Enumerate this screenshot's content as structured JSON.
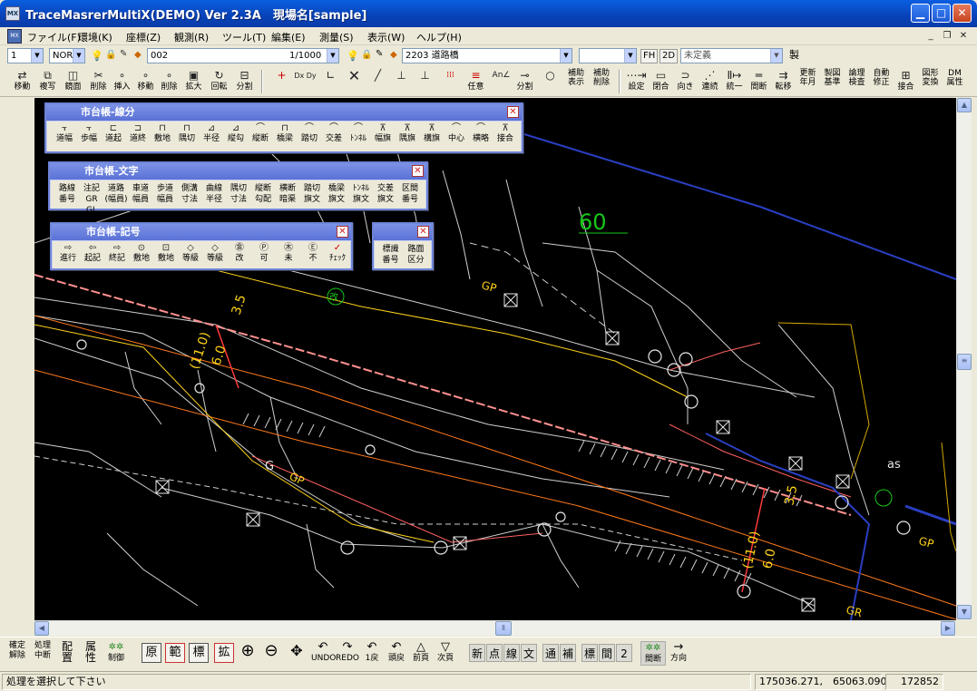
{
  "window": {
    "title": "TraceMasrerMultiX(DEMO) Ver 2.3A　現場名[sample]",
    "app_icon": "MX"
  },
  "menu": [
    "ファイル(F)",
    "環境(K)",
    "座標(Z)",
    "観測(R)",
    "ツール(T)",
    "編集(E)",
    "測量(S)",
    "表示(W)",
    "ヘルプ(H)"
  ],
  "row2": {
    "layer": "1",
    "mode": "NOR",
    "drawing_code": "002",
    "scale": "1/1000",
    "road_code": "2203 道路橋",
    "blank_combo": "",
    "fh": "FH",
    "twod": "2D",
    "undefined": "未定義",
    "make": "製"
  },
  "toolbar": [
    {
      "l1": "移動",
      "icon": "⇄"
    },
    {
      "l1": "複写",
      "icon": "⧉"
    },
    {
      "l1": "鏡面",
      "icon": "◫"
    },
    {
      "l1": "削除",
      "icon": "✂"
    },
    {
      "l1": "挿入",
      "icon": "∘"
    },
    {
      "l1": "移動",
      "icon": "∘"
    },
    {
      "l1": "削除",
      "icon": "∘"
    },
    {
      "l1": "拡大",
      "icon": "▣"
    },
    {
      "l1": "回転",
      "icon": "↻"
    },
    {
      "l1": "分割",
      "icon": "⊟"
    }
  ],
  "toolbar_mid": {
    "aux": "任意",
    "split": "分割",
    "hojo1": "補助",
    "disp": "表示",
    "hojo2": "補助",
    "del": "削除"
  },
  "toolbar_right": [
    {
      "l1": "",
      "l2": "設定"
    },
    {
      "l1": "",
      "l2": "閉合"
    },
    {
      "l1": "",
      "l2": "向き"
    },
    {
      "l1": "",
      "l2": "連続"
    },
    {
      "l1": "",
      "l2": "統一"
    },
    {
      "l1": "",
      "l2": "間断"
    },
    {
      "l1": "",
      "l2": "転移"
    },
    {
      "l1": "更新",
      "l2": "年月"
    },
    {
      "l1": "製図",
      "l2": "基準"
    },
    {
      "l1": "論理",
      "l2": "検査"
    },
    {
      "l1": "自動",
      "l2": "修正"
    },
    {
      "l1": "",
      "l2": "接合"
    },
    {
      "l1": "図形",
      "l2": "変換"
    },
    {
      "l1": "DM",
      "l2": "属性"
    }
  ],
  "palettes": {
    "lines": {
      "title": "市台帳-線分",
      "items": [
        "道幅",
        "歩幅",
        "道起",
        "道終",
        "敷地",
        "隅切",
        "半径",
        "縦勾",
        "縦断",
        "橋梁",
        "踏切",
        "交差",
        "ﾄﾝﾈﾙ",
        "幅旗",
        "隅旗",
        "構旗",
        "中心",
        "横略",
        "接合"
      ]
    },
    "text": {
      "title": "市台帳-文字",
      "items": [
        [
          "路線",
          "番号"
        ],
        [
          "注記",
          "GR GL"
        ],
        [
          "道路",
          "(幅員)"
        ],
        [
          "車道",
          "幅員"
        ],
        [
          "歩道",
          "幅員"
        ],
        [
          "側溝",
          "寸法"
        ],
        [
          "曲線",
          "半径"
        ],
        [
          "隅切",
          "寸法"
        ],
        [
          "縦断",
          "勾配"
        ],
        [
          "横断",
          "暗渠"
        ],
        [
          "踏切",
          "旗文"
        ],
        [
          "橋梁",
          "旗文"
        ],
        [
          "ﾄﾝﾈﾙ",
          "旗文"
        ],
        [
          "交差",
          "旗文"
        ],
        [
          "区間",
          "番号"
        ]
      ]
    },
    "symbols": {
      "title": "市台帳-記号",
      "items": [
        "進行",
        "起記",
        "終記",
        "敷地",
        "敷地",
        "等級",
        "等級",
        "改",
        "可",
        "未",
        "不",
        "ﾁｪｯｸ"
      ]
    },
    "small": {
      "items": [
        [
          "標識",
          "番号"
        ],
        [
          "路面",
          "区分"
        ]
      ]
    }
  },
  "drawing_labels": {
    "num60": "60",
    "gp1": "GP",
    "gp2": "GP",
    "gp3": "GP",
    "g": "G",
    "as": "as",
    "gr": "GR",
    "kai": "改",
    "w1": "(11.0)",
    "w2": "6.0",
    "w3": "3.5"
  },
  "bottom": {
    "left": [
      [
        "確定",
        "解除"
      ],
      [
        "処理",
        "中断"
      ],
      [
        "配",
        "置"
      ],
      [
        "属",
        "性"
      ],
      [
        "",
        "制御"
      ]
    ],
    "boxes": [
      "原",
      "範",
      "標",
      "拡"
    ],
    "nav": [
      {
        "icon": "⊕",
        "l": ""
      },
      {
        "icon": "⊖",
        "l": ""
      },
      {
        "icon": "✥",
        "l": ""
      },
      {
        "icon": "↶",
        "l": "UNDO"
      },
      {
        "icon": "↷",
        "l": "REDO"
      },
      {
        "icon": "↶",
        "l": "1戻"
      },
      {
        "icon": "↶",
        "l": "頭戻"
      },
      {
        "icon": "△",
        "l": "前頁"
      },
      {
        "icon": "▽",
        "l": "次頁"
      }
    ],
    "flat1": [
      "新",
      "点",
      "線",
      "文"
    ],
    "flat2": [
      "通",
      "補"
    ],
    "flat3": [
      "標",
      "間",
      "2"
    ],
    "right": [
      [
        "",
        "間断"
      ],
      [
        "",
        "方向"
      ]
    ]
  },
  "status": {
    "message": "処理を選択して下さい",
    "coords": "175036.271,　65063.090",
    "count": "172852"
  },
  "colors": {
    "title_blue": "#0842b8",
    "canvas": "#000000",
    "palette_title": "#5a72d6"
  }
}
